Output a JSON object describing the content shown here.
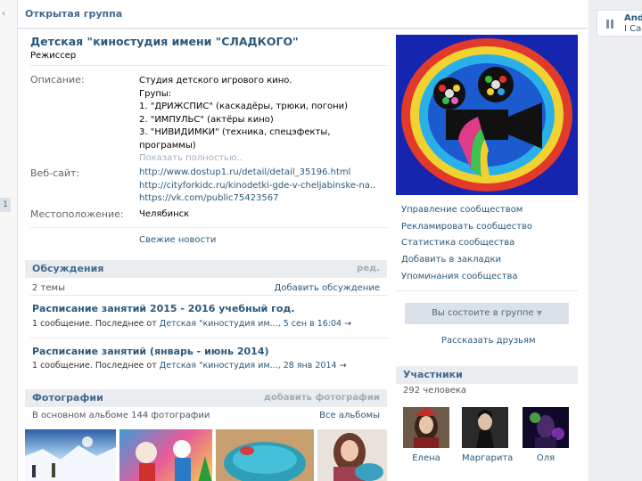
{
  "header": {
    "title": "Открытая группа"
  },
  "left_edge": {
    "chevron": "‹",
    "badge": "1"
  },
  "group": {
    "name": "Детская \"киностудия имени \"СЛАДКОГО\"",
    "status": "Режиссер",
    "description_label": "Описание:",
    "description_lines": [
      "Студия детского игрового кино.",
      "Групы:",
      "1. \"ДРИЖСПИС\" (каскадёры, трюки, погони)",
      "2. \"ИМПУЛЬС\" (актёры кино)",
      "3. \"НИВИДИМКИ\" (техника, спецэфекты,",
      "программы)"
    ],
    "show_more": "Показать полностью..",
    "website_label": "Веб-сайт:",
    "websites": [
      "http://www.dostup1.ru/detail/detail_35196.html",
      "http://cityforkidc.ru/kinodetki-gde-v-cheljabinske-na..",
      "https://vk.com/public75423567"
    ],
    "location_label": "Местоположение:",
    "location": "Челябинск",
    "news_link": "Свежие новости"
  },
  "discussions": {
    "title": "Обсуждения",
    "edit": "ред.",
    "count": "2 темы",
    "add": "Добавить обсуждение",
    "topics": [
      {
        "title": "Расписание занятий 2015 - 2016 учебный год.",
        "meta_prefix": "1 сообщение. Последнее от",
        "author": "Детская \"киностудия им...",
        "date": ", 5 сен в 16:04",
        "arrow": "→"
      },
      {
        "title": "Расписание занятий (январь - июнь 2014)",
        "meta_prefix": "1 сообщение. Последнее от",
        "author": "Детская \"киностудия им...",
        "date": ", 28 янв 2014",
        "arrow": "→"
      }
    ]
  },
  "photos": {
    "title": "Фотографии",
    "add": "добавить фотографии",
    "album_info": "В основном альбоме 144 фотографии",
    "all_albums": "Все альбомы"
  },
  "sidebar": {
    "menu": [
      "Управление сообществом",
      "Рекламировать сообщество",
      "Статистика сообщества",
      "Добавить в закладки",
      "Упоминания сообщества"
    ],
    "member_button": "Вы состоите в группе",
    "tell_friends": "Рассказать друзьям",
    "members_title": "Участники",
    "members_count": "292 человека",
    "members": [
      {
        "name": "Елена"
      },
      {
        "name": "Маргарита"
      },
      {
        "name": "Оля"
      }
    ]
  },
  "right_column": {
    "line1": "And",
    "line2": "I Ca"
  },
  "colors": {
    "link": "#2b587a",
    "header": "#45688e",
    "block_bg": "#eaedf0"
  }
}
